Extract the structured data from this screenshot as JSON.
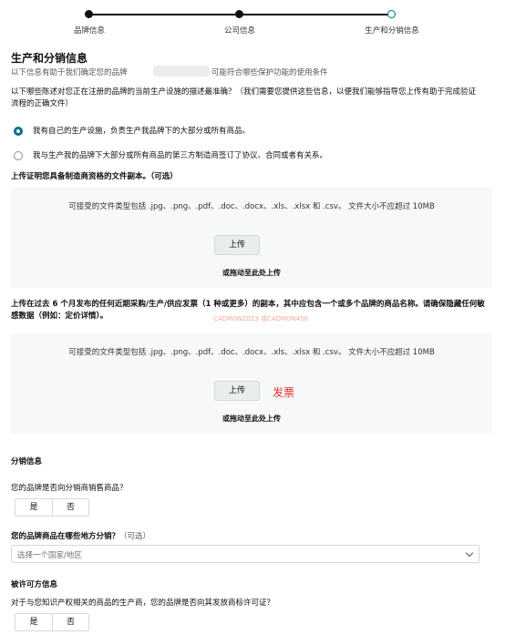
{
  "stepper": {
    "steps": [
      {
        "label": "品牌信息"
      },
      {
        "label": "公司信息"
      },
      {
        "label": "生产和分销信息"
      }
    ]
  },
  "production": {
    "title": "生产和分销信息",
    "subtitle_prefix": "以下信息有助于我们确定您的品牌",
    "subtitle_suffix": "可能符合哪些保护功能的使用条件",
    "question": "以下哪些陈述对您正在注册的品牌的当前生产设施的描述最准确？（我们需要您提供这些信息，以便我们能够指导您上传有助于完成验证流程的正确文件）",
    "options": [
      {
        "label": "我有自己的生产设施，负责生产我品牌下的大部分或所有商品。",
        "selected": true
      },
      {
        "label": "我与生产我的品牌下大部分或所有商品的第三方制造商签订了协议、合同或者有关系。",
        "selected": false
      }
    ]
  },
  "upload1": {
    "title": "上传证明您具备制造商资格的文件副本。",
    "optional": "（可选）",
    "hint": "可接受的文件类型包括 .jpg、.png、.pdf、.doc、.docx、.xls、.xlsx 和 .csv。    文件大小不应超过 10MB",
    "button": "上传",
    "drag_text": "或拖动至此处上传"
  },
  "upload2": {
    "title": "上传在过去 6 个月发布的任何近期采购/生产/供应发票（1 种或更多）的副本，其中应包含一个或多个品牌的商品名称。请确保隐藏任何敏感数据（例如：定价详情）。",
    "watermark": "CADMON2023 或CADMON456",
    "hint": "可接受的文件类型包括 .jpg、.png、.pdf、.doc、.docx、.xls、.xlsx 和 .csv。    文件大小不应超过 10MB",
    "button": "上传",
    "annotation": "发票",
    "drag_text": "或拖动至此处上传"
  },
  "distribution": {
    "title": "分销信息",
    "question": "您的品牌是否向分销商销售商品？",
    "yes": "是",
    "no": "否",
    "where_label": "您的品牌商品在哪些地方分销？",
    "where_optional": "（可选）",
    "select_placeholder": "选择一个国家/地区"
  },
  "license": {
    "title": "被许可方信息",
    "question": "对于与您知识产权相关的商品的生产商，您的品牌是否向其发放商标许可证？",
    "yes": "是",
    "no": "否"
  },
  "colors": {
    "accent": "#007185",
    "annotation_red": "#e0322b"
  }
}
